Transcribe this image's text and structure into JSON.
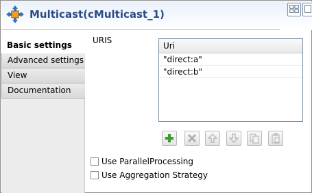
{
  "header": {
    "title": "Multicast(cMulticast_1)",
    "icon": "multicast-component-icon",
    "title_color": "#2b4a86"
  },
  "tabs": [
    {
      "label": "Basic settings",
      "active": true
    },
    {
      "label": "Advanced settings",
      "active": false
    },
    {
      "label": "View",
      "active": false
    },
    {
      "label": "Documentation",
      "active": false
    }
  ],
  "uris": {
    "label": "URIS",
    "column_header": "Uri",
    "rows": [
      "\"direct:a\"",
      "\"direct:b\""
    ]
  },
  "toolbar": {
    "buttons": [
      "add-icon",
      "delete-icon",
      "move-up-icon",
      "move-down-icon",
      "copy-icon",
      "paste-icon"
    ]
  },
  "options": {
    "parallel_processing": {
      "label": "Use ParallelProcessing",
      "checked": false
    },
    "aggregation_strategy": {
      "label": "Use Aggregation Strategy",
      "checked": false
    }
  }
}
